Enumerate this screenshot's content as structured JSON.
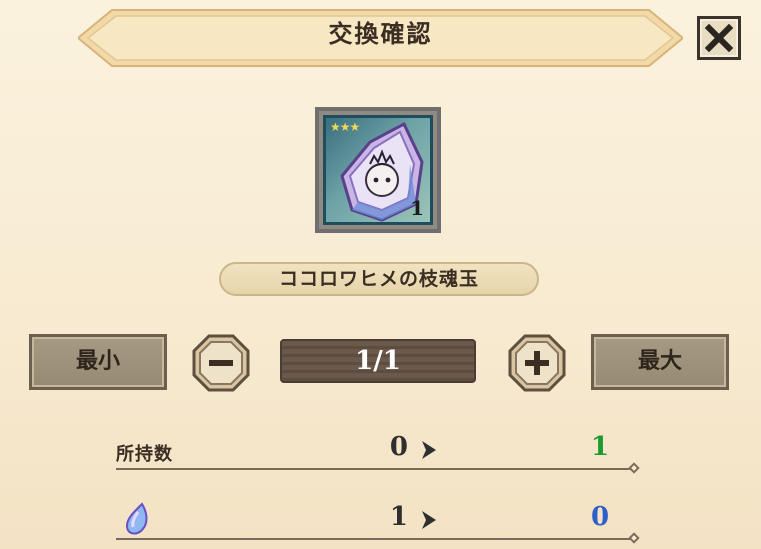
{
  "header": {
    "title": "交換確認",
    "close_icon": "close-x-icon"
  },
  "item": {
    "name": "ココロワヒメの枝魂玉",
    "quantity_badge": "1",
    "star_rating": 3,
    "star_glyphs": "★★★",
    "icon": "soul-crystal-icon"
  },
  "quantity_selector": {
    "min_label": "最小",
    "max_label": "最大",
    "value": "1/1",
    "minus_icon": "minus-icon",
    "plus_icon": "plus-icon"
  },
  "rows": [
    {
      "label": "所持数",
      "before": "0",
      "after": "1",
      "after_color": "#1e9b2e"
    },
    {
      "icon": "crystal-drop-icon",
      "before": "1",
      "after": "0",
      "after_color": "#2f5fc8"
    }
  ]
}
